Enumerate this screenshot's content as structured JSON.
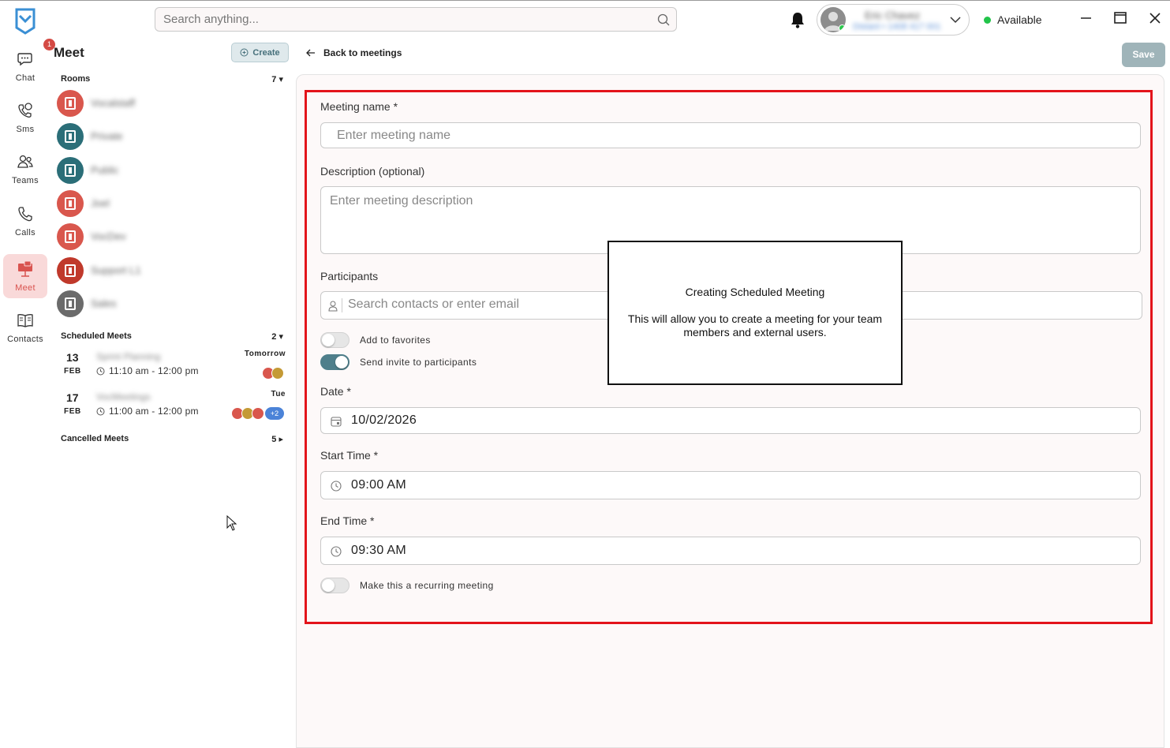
{
  "topbar": {
    "search_placeholder": "Search anything...",
    "user_name": "Eric Chavez",
    "user_sub": "Distant • 1408 417 001",
    "status": "Available"
  },
  "rail": {
    "items": [
      {
        "label": "Chat",
        "icon": "chat-icon"
      },
      {
        "label": "Sms",
        "icon": "sms-icon"
      },
      {
        "label": "Teams",
        "icon": "teams-icon"
      },
      {
        "label": "Calls",
        "icon": "phone-icon"
      },
      {
        "label": "Meet",
        "icon": "meet-icon",
        "active": true
      },
      {
        "label": "Contacts",
        "icon": "contacts-icon"
      }
    ]
  },
  "sidebar": {
    "badge": "1",
    "title": "Meet",
    "create_label": "Create",
    "rooms_label": "Rooms",
    "rooms_count": "7",
    "rooms": [
      {
        "name": "Vocalstaff",
        "color": "#d9574d"
      },
      {
        "name": "Private",
        "color": "#2b6e78"
      },
      {
        "name": "Public",
        "color": "#2b6e78"
      },
      {
        "name": "Joel",
        "color": "#d9574d"
      },
      {
        "name": "VocDev",
        "color": "#d9574d"
      },
      {
        "name": "Support L1",
        "color": "#c0392b"
      },
      {
        "name": "Sales",
        "color": "#6b6b6b"
      }
    ],
    "scheduled_label": "Scheduled Meets",
    "scheduled_count": "2",
    "meets": [
      {
        "day": "13",
        "month": "FEB",
        "name": "Sprint Planning",
        "time": "11:10 am - 12:00 pm",
        "when": "Tomorrow"
      },
      {
        "day": "17",
        "month": "FEB",
        "name": "VocMeetings",
        "time": "11:00 am - 12:00 pm",
        "when": "Tue",
        "extra": "+2"
      }
    ],
    "cancelled_label": "Cancelled Meets",
    "cancelled_count": "5"
  },
  "main": {
    "back_label": "Back to meetings",
    "save_label": "Save",
    "name_label": "Meeting name *",
    "name_placeholder": "Enter meeting name",
    "desc_label": "Description (optional)",
    "desc_placeholder": "Enter meeting description",
    "participants_label": "Participants",
    "participants_placeholder": "Search contacts or enter email",
    "favorites_label": "Add to favorites",
    "invite_label": "Send invite to participants",
    "date_label": "Date *",
    "date_value": "10/02/2026",
    "start_label": "Start Time *",
    "start_value": "09:00 AM",
    "end_label": "End Time *",
    "end_value": "09:30 AM",
    "recurring_label": "Make this a recurring meeting"
  },
  "overlay": {
    "title": "Creating Scheduled Meeting",
    "body": "This will allow you to create a meeting for your team members and external users."
  }
}
